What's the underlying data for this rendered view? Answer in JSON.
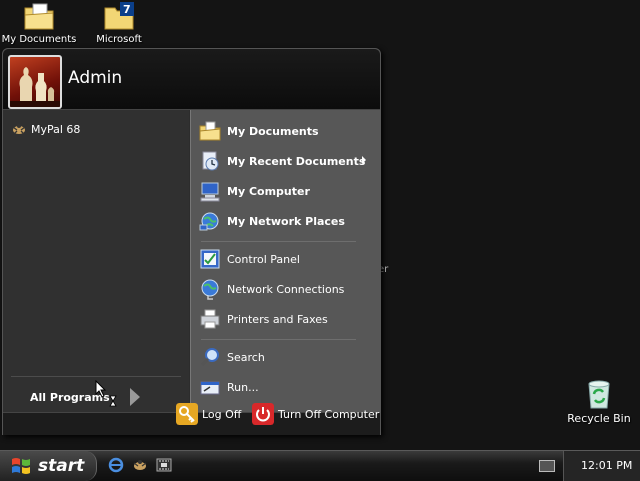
{
  "desktop": {
    "icons": [
      {
        "label": "My Documents"
      },
      {
        "label": "Microsoft"
      },
      {
        "label": "Recycle Bin"
      }
    ],
    "partial_label": "er"
  },
  "start_menu": {
    "user": "Admin",
    "pinned": [
      {
        "label": "MyPal 68"
      }
    ],
    "all_programs": "All Programs",
    "places": [
      {
        "label": "My Documents",
        "bold": true
      },
      {
        "label": "My Recent Documents",
        "bold": true,
        "submenu": true
      },
      {
        "label": "My Computer",
        "bold": true
      },
      {
        "label": "My Network Places",
        "bold": true
      }
    ],
    "system": [
      {
        "label": "Control Panel"
      },
      {
        "label": "Network Connections"
      },
      {
        "label": "Printers and Faxes"
      }
    ],
    "tools": [
      {
        "label": "Search"
      },
      {
        "label": "Run..."
      }
    ],
    "footer": {
      "log_off": "Log Off",
      "turn_off": "Turn Off Computer"
    }
  },
  "taskbar": {
    "start_label": "start",
    "clock": "12:01 PM"
  },
  "icons": {
    "logoff_color": "#e6a723",
    "turnoff_color": "#d8282a",
    "folder_color": "#f2d675"
  }
}
